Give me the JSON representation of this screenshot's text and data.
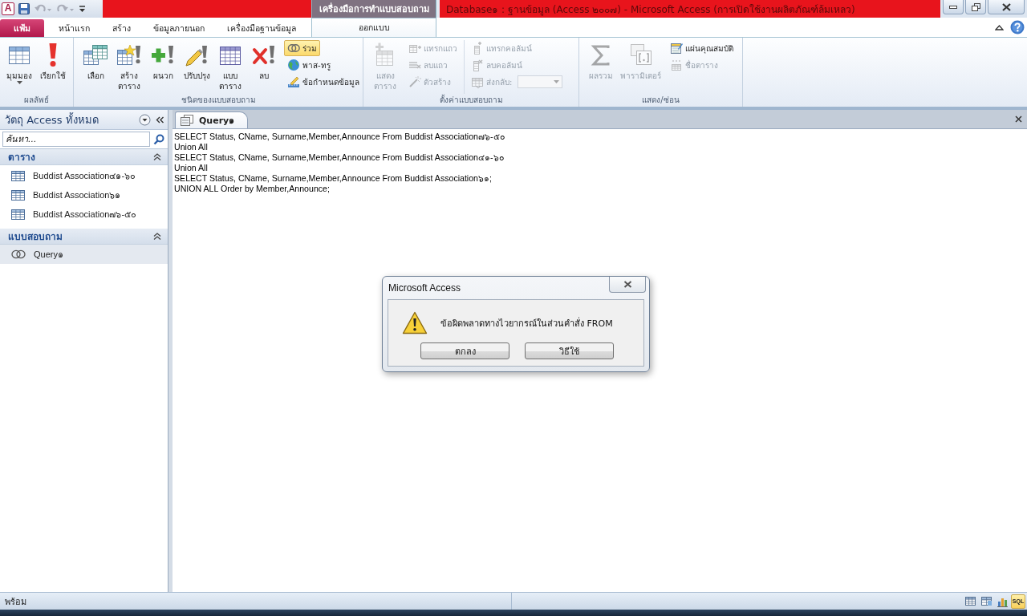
{
  "window": {
    "logo": "A",
    "title": "Database๑ : ฐานข้อมูล (Access ๒๐๐๗) - Microsoft Access (การเปิดใช้งานผลิตภัณฑ์ล้มเหลว)",
    "context_tab": "เครื่องมือการทำแบบสอบถาม"
  },
  "quick_access": [
    {
      "disabled": false
    },
    {
      "disabled": true
    },
    {
      "disabled": true
    }
  ],
  "ribbon_tabs": [
    {
      "label": "แฟ้ม",
      "kind": "file",
      "selected": false
    },
    {
      "label": "หน้าแรก",
      "kind": "tab",
      "selected": false
    },
    {
      "label": "สร้าง",
      "kind": "tab",
      "selected": false
    },
    {
      "label": "ข้อมูลภายนอก",
      "kind": "tab",
      "selected": false
    },
    {
      "label": "เครื่องมือฐานข้อมูล",
      "kind": "tab",
      "selected": false
    },
    {
      "label": "ออกแบบ",
      "kind": "context",
      "selected": true
    }
  ],
  "ribbon_groups": [
    {
      "label": "ผลลัพธ์",
      "controls": [
        {
          "kind": "large",
          "label": "มุมมอง",
          "dropdown": true
        },
        {
          "kind": "large",
          "label": "เรียกใช้",
          "dropdown": false
        }
      ]
    },
    {
      "label": "ชนิดของแบบสอบถาม",
      "controls": [
        {
          "kind": "large",
          "label": "เลือก",
          "selected": false
        },
        {
          "kind": "large",
          "label": "สร้าง\nตาราง",
          "selected": false
        },
        {
          "kind": "large",
          "label": "ผนวก",
          "selected": false
        },
        {
          "kind": "large",
          "label": "ปรับปรุง",
          "selected": false
        },
        {
          "kind": "large",
          "label": "แบบ\nตาราง",
          "selected": false
        },
        {
          "kind": "large",
          "label": "ลบ",
          "selected": false
        },
        {
          "kind": "stack",
          "items": [
            {
              "label": "ร่วม",
              "selected": true
            },
            {
              "label": "พาส-ทรู",
              "selected": false
            },
            {
              "label": "ข้อกำหนดข้อมูล",
              "selected": false
            }
          ]
        }
      ]
    },
    {
      "label": "ตั้งค่าแบบสอบถาม",
      "controls": [
        {
          "kind": "large",
          "label": "แสดง\nตาราง",
          "disabled": true
        },
        {
          "kind": "stack",
          "items": [
            {
              "kind": "button",
              "label": "แทรกแถว",
              "disabled": true
            },
            {
              "kind": "button",
              "label": "ลบแถว",
              "disabled": true
            },
            {
              "kind": "button",
              "label": "ตัวสร้าง",
              "disabled": true
            }
          ]
        },
        {
          "kind": "stack",
          "items": [
            {
              "kind": "button",
              "label": "แทรกคอลัมน์",
              "disabled": true
            },
            {
              "kind": "button",
              "label": "ลบคอลัมน์",
              "disabled": true
            },
            {
              "kind": "combo",
              "label": "ส่งกลับ:",
              "disabled": true
            }
          ]
        }
      ]
    },
    {
      "label": "แสดง/ซ่อน",
      "controls": [
        {
          "kind": "large",
          "label": "ผลรวม",
          "disabled": true
        },
        {
          "kind": "large",
          "label": "พารามิเตอร์",
          "disabled": true
        },
        {
          "kind": "stack",
          "items": [
            {
              "label": "แผ่นคุณสมบัติ",
              "disabled": false
            },
            {
              "label": "ชื่อตาราง",
              "disabled": true
            }
          ]
        }
      ]
    }
  ],
  "nav_pane": {
    "title": "วัตถุ Access ทั้งหมด",
    "search": {
      "placeholder": "ค้นหา..."
    },
    "groups": [
      {
        "label": "ตาราง",
        "expanded": true,
        "items": [
          {
            "kind": "table",
            "label": "Buddist Association๔๑-๖๐",
            "selected": false
          },
          {
            "kind": "table",
            "label": "Buddist Association๖๑",
            "selected": false
          },
          {
            "kind": "table",
            "label": "Buddist Association๗๖-๕๐",
            "selected": false
          }
        ]
      },
      {
        "label": "แบบสอบถาม",
        "expanded": true,
        "items": [
          {
            "kind": "query",
            "label": "Query๑",
            "selected": true
          }
        ]
      }
    ]
  },
  "document": {
    "tabs": [
      {
        "label": "Query๑",
        "selected": true
      }
    ],
    "sql_lines": [
      "SELECT Status, CName, Surname,Member,Announce From Buddist Association๗๖-๕๐",
      "Union All",
      "SELECT Status, CName, Surname,Member,Announce From Buddist Association๔๑-๖๐",
      "Union All",
      "SELECT Status, CName, Surname,Member,Announce From Buddist Association๖๑;",
      "UNION ALL Order by Member,Announce;"
    ]
  },
  "dialog": {
    "title": "Microsoft Access",
    "message": "ข้อผิดพลาดทางไวยากรณ์ในส่วนคำสั่ง FROM",
    "buttons": [
      "ตกลง",
      "วิธีใช้"
    ]
  },
  "status_bar": {
    "text": "พร้อม",
    "views": [
      {
        "kind": "icon",
        "selected": false
      },
      {
        "kind": "icon",
        "selected": false
      },
      {
        "kind": "icon",
        "selected": false
      },
      {
        "kind": "text",
        "label": "SQL",
        "selected": true
      }
    ]
  }
}
